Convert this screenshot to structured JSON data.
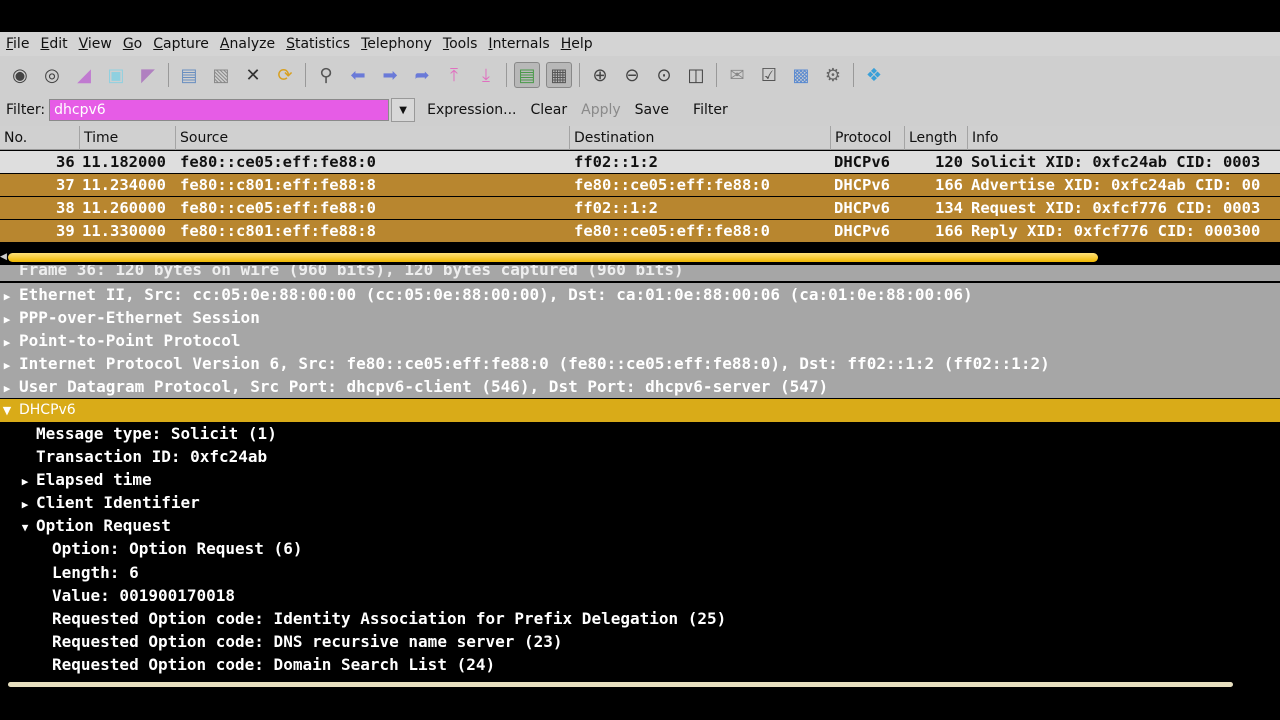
{
  "menu": [
    "File",
    "Edit",
    "View",
    "Go",
    "Capture",
    "Analyze",
    "Statistics",
    "Telephony",
    "Tools",
    "Internals",
    "Help"
  ],
  "toolbar_icons": [
    "interface-list-icon",
    "capture-options-icon",
    "start-capture-icon",
    "stop-capture-icon",
    "restart-capture-icon",
    "open-file-icon",
    "save-file-icon",
    "close-file-icon",
    "reload-icon",
    "find-packet-icon",
    "go-back-icon",
    "go-forward-icon",
    "go-to-packet-icon",
    "go-first-icon",
    "go-last-icon",
    "colorize-icon",
    "auto-scroll-icon",
    "zoom-in-icon",
    "zoom-out-icon",
    "zoom-normal-icon",
    "resize-columns-icon",
    "capture-filters-icon",
    "display-filters-icon",
    "coloring-rules-icon",
    "preferences-icon",
    "help-icon"
  ],
  "filter": {
    "label": "Filter:",
    "value": "dhcpv6",
    "expression": "Expression...",
    "clear": "Clear",
    "apply": "Apply",
    "save": "Save",
    "filter_btn": "Filter"
  },
  "columns": [
    "No.",
    "Time",
    "Source",
    "Destination",
    "Protocol",
    "Length",
    "Info"
  ],
  "packets": [
    {
      "no": "36",
      "time": "11.182000",
      "src": "fe80::ce05:eff:fe88:0",
      "dst": "ff02::1:2",
      "proto": "DHCPv6",
      "len": "120",
      "info": "Solicit XID: 0xfc24ab CID: 0003"
    },
    {
      "no": "37",
      "time": "11.234000",
      "src": "fe80::c801:eff:fe88:8",
      "dst": "fe80::ce05:eff:fe88:0",
      "proto": "DHCPv6",
      "len": "166",
      "info": "Advertise XID: 0xfc24ab CID: 00"
    },
    {
      "no": "38",
      "time": "11.260000",
      "src": "fe80::ce05:eff:fe88:0",
      "dst": "ff02::1:2",
      "proto": "DHCPv6",
      "len": "134",
      "info": "Request XID: 0xfcf776 CID: 0003"
    },
    {
      "no": "39",
      "time": "11.330000",
      "src": "fe80::c801:eff:fe88:8",
      "dst": "fe80::ce05:eff:fe88:0",
      "proto": "DHCPv6",
      "len": "166",
      "info": "Reply XID: 0xfcf776 CID: 000300"
    }
  ],
  "details": {
    "frame": "Frame 36: 120 bytes on wire (960 bits), 120 bytes captured (960 bits)",
    "ethernet": "Ethernet II, Src: cc:05:0e:88:00:00 (cc:05:0e:88:00:00), Dst: ca:01:0e:88:00:06 (ca:01:0e:88:00:06)",
    "pppoe": "PPP-over-Ethernet Session",
    "ppp": "Point-to-Point Protocol",
    "ipv6": "Internet Protocol Version 6, Src: fe80::ce05:eff:fe88:0 (fe80::ce05:eff:fe88:0), Dst: ff02::1:2 (ff02::1:2)",
    "udp": "User Datagram Protocol, Src Port: dhcpv6-client (546), Dst Port: dhcpv6-server (547)",
    "dhcpv6": "DHCPv6",
    "msg_type": "Message type: Solicit (1)",
    "txid": "Transaction ID: 0xfc24ab",
    "elapsed": "Elapsed time",
    "client_id": "Client Identifier",
    "option_request": "Option Request",
    "opt_option": "Option: Option Request (6)",
    "opt_length": "Length: 6",
    "opt_value": "Value: 001900170018",
    "req1": "Requested Option code: Identity Association for Prefix Delegation (25)",
    "req2": "Requested Option code: DNS recursive name server (23)",
    "req3": "Requested Option code: Domain Search List (24)"
  },
  "colors": {
    "dhcp_row": "#b8862f",
    "selected_row": "#dedede",
    "filter_bg": "#e65ce6",
    "protocol_highlight": "#d9ab18"
  }
}
